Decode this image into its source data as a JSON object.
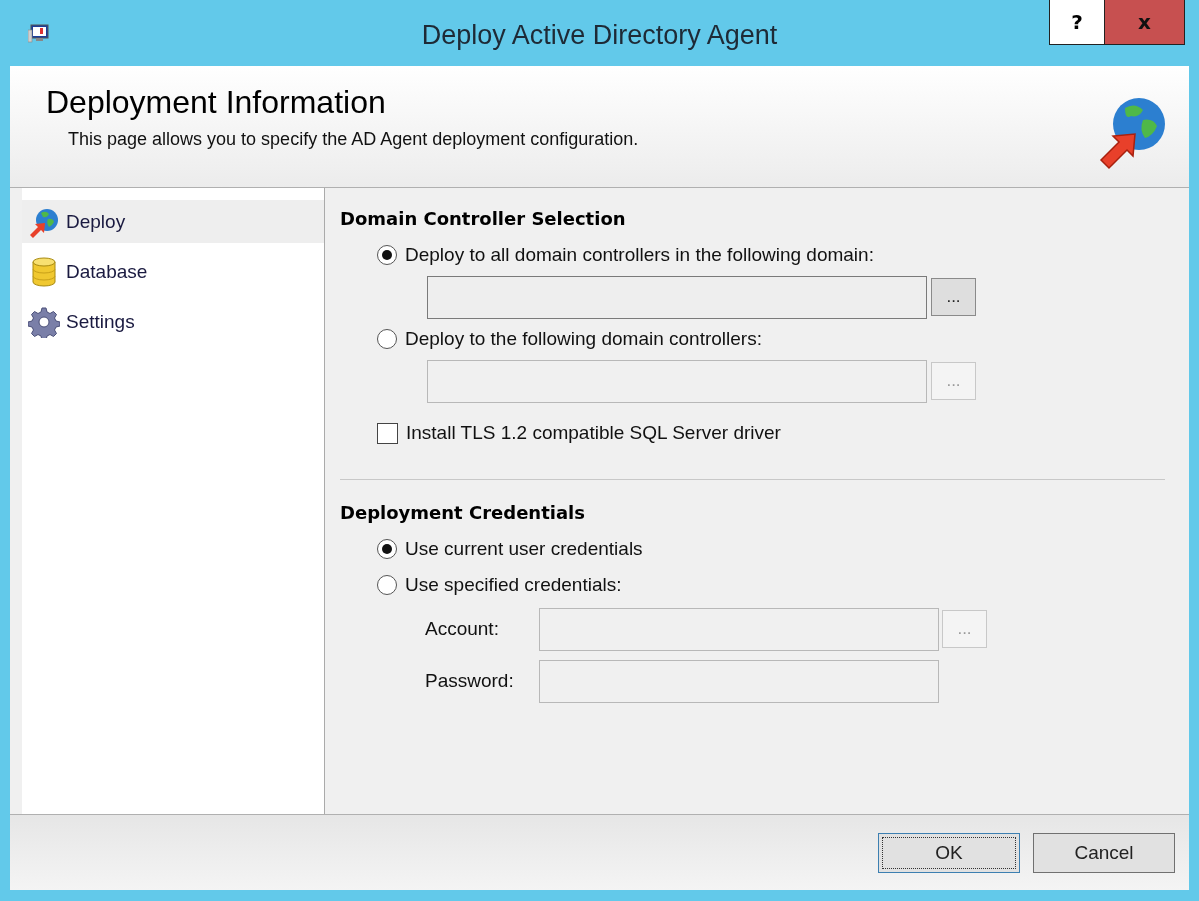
{
  "window": {
    "title": "Deploy Active Directory Agent",
    "help": "?",
    "close": "x"
  },
  "header": {
    "title": "Deployment Information",
    "subtitle": "This page allows you to specify the AD Agent deployment configuration."
  },
  "sidebar": {
    "items": [
      {
        "label": "Deploy",
        "kind": "deploy",
        "selected": true
      },
      {
        "label": "Database",
        "kind": "database",
        "selected": false
      },
      {
        "label": "Settings",
        "kind": "settings",
        "selected": false
      }
    ]
  },
  "sections": [
    {
      "title": "Domain Controller Selection",
      "items": [
        {
          "kind": "radio",
          "label": "Deploy to all domain controllers in the following domain:",
          "selected": true
        },
        {
          "kind": "field",
          "disabled": false,
          "browse": "..."
        },
        {
          "kind": "radio",
          "label": "Deploy to the following domain controllers:",
          "selected": false
        },
        {
          "kind": "field",
          "disabled": true,
          "browse": "..."
        },
        {
          "kind": "checkbox",
          "label": "Install TLS 1.2 compatible SQL Server driver",
          "checked": false
        }
      ]
    },
    {
      "title": "Deployment Credentials",
      "items": [
        {
          "kind": "radio",
          "label": "Use current user credentials",
          "selected": true
        },
        {
          "kind": "radio",
          "label": "Use specified credentials:",
          "selected": false
        },
        {
          "kind": "labeled_field",
          "label": "Account:",
          "disabled": true,
          "browse": "..."
        },
        {
          "kind": "labeled_field",
          "label": "Password:",
          "disabled": true
        }
      ]
    }
  ],
  "buttons": [
    {
      "label": "OK",
      "default": true
    },
    {
      "label": "Cancel",
      "default": false
    }
  ]
}
